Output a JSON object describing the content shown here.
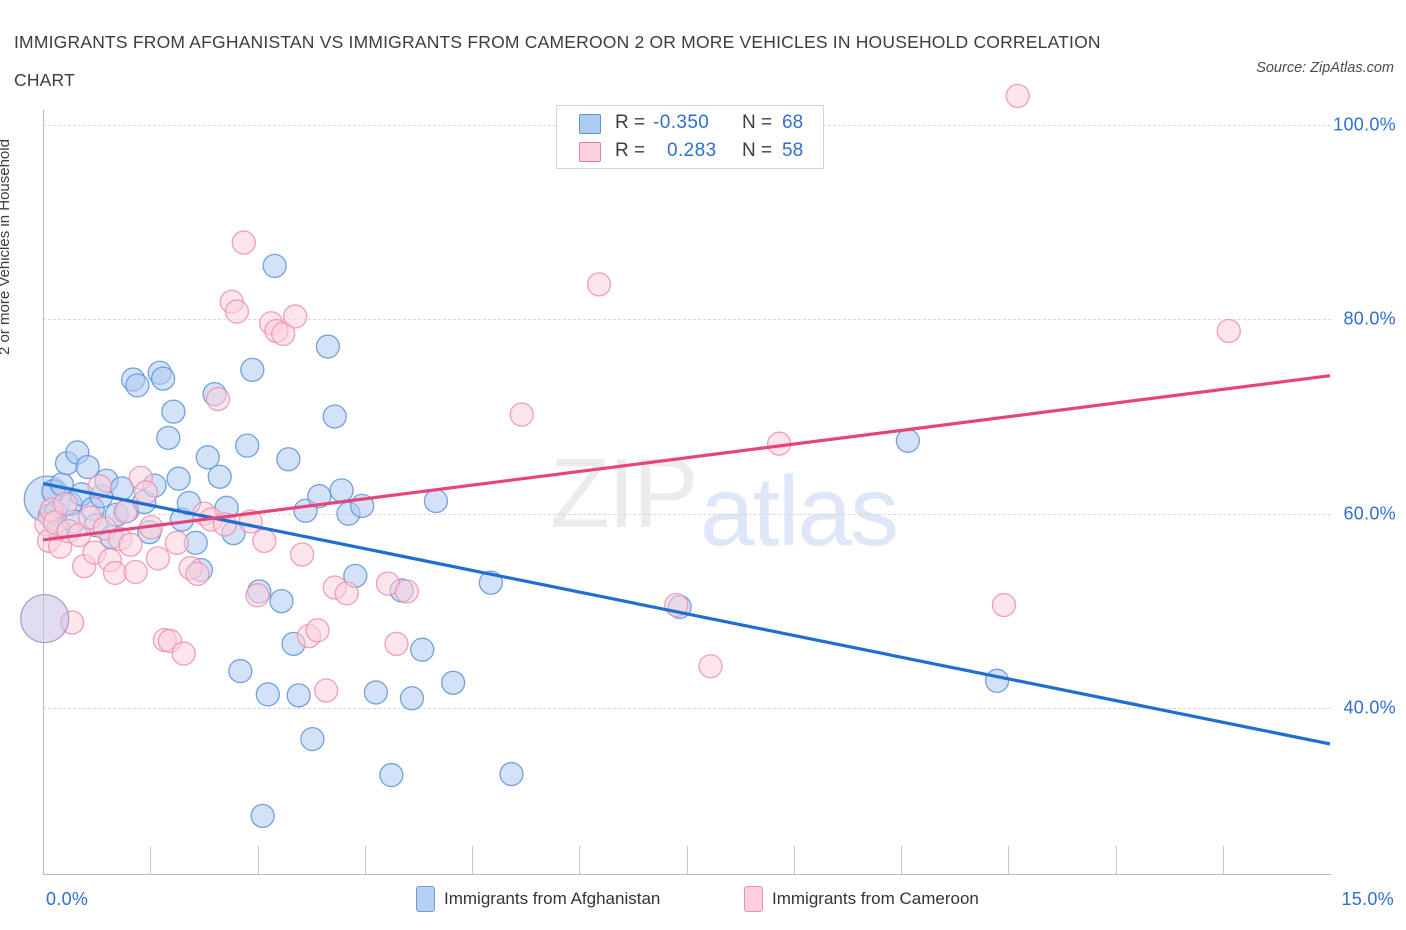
{
  "header": {
    "title_line1": "IMMIGRANTS FROM AFGHANISTAN VS IMMIGRANTS FROM CAMEROON 2 OR MORE VEHICLES IN HOUSEHOLD CORRELATION",
    "title_line2": "CHART",
    "source": "Source: ZipAtlas.com"
  },
  "watermark": {
    "part1": "ZIP",
    "part2": "atlas"
  },
  "stats": {
    "rows": [
      {
        "r_label": "R =",
        "r_value": "-0.350",
        "n_label": "N =",
        "n_value": "68",
        "color": "#aecbf0"
      },
      {
        "r_label": "R =",
        "r_value": "0.283",
        "n_label": "N =",
        "n_value": "58",
        "color": "#fbcfdd"
      }
    ]
  },
  "legend": {
    "items": [
      {
        "label": "Immigrants from Afghanistan",
        "color": "#b6d0f2"
      },
      {
        "label": "Immigrants from Cameroon",
        "color": "#fbcfdd"
      }
    ]
  },
  "chart_data": {
    "type": "scatter",
    "title": "IMMIGRANTS FROM AFGHANISTAN VS IMMIGRANTS FROM CAMEROON 2 OR MORE VEHICLES IN HOUSEHOLD CORRELATION CHART",
    "xlabel": "",
    "ylabel": "2 or more Vehicles in Household",
    "xlim": [
      0,
      15
    ],
    "ylim": [
      22.3,
      103.5
    ],
    "xtick_labels": [
      "0.0%",
      "15.0%"
    ],
    "ytick_labels": [
      "100.0%",
      "80.0%",
      "60.0%",
      "40.0%"
    ],
    "ytick_values": [
      100,
      80,
      60,
      40
    ],
    "grid": true,
    "legend_position": "bottom-center",
    "series": [
      {
        "name": "Immigrants from Afghanistan",
        "color": "#aecbf0",
        "edge": "#5d93d8",
        "r": -0.35,
        "n": 68,
        "trendline": {
          "x0": 0.0,
          "y0": 63.1,
          "x1": 15.0,
          "y1": 36.3,
          "color": "#1f6fd0"
        },
        "points": [
          [
            0.05,
            61.5
          ],
          [
            0.08,
            59.8
          ],
          [
            0.12,
            62.3
          ],
          [
            0.15,
            60.1
          ],
          [
            0.18,
            58.4
          ],
          [
            0.22,
            63.0
          ],
          [
            0.28,
            65.2
          ],
          [
            0.32,
            61.0
          ],
          [
            0.36,
            59.2
          ],
          [
            0.4,
            66.3
          ],
          [
            0.45,
            62.0
          ],
          [
            0.52,
            64.8
          ],
          [
            0.58,
            60.5
          ],
          [
            0.62,
            58.8
          ],
          [
            0.68,
            61.8
          ],
          [
            0.74,
            63.4
          ],
          [
            0.8,
            57.6
          ],
          [
            0.86,
            59.9
          ],
          [
            0.92,
            62.6
          ],
          [
            0.98,
            60.3
          ],
          [
            1.05,
            73.8
          ],
          [
            1.1,
            73.2
          ],
          [
            1.18,
            61.2
          ],
          [
            1.24,
            58.1
          ],
          [
            1.3,
            62.9
          ],
          [
            1.36,
            74.5
          ],
          [
            1.4,
            73.9
          ],
          [
            1.46,
            67.8
          ],
          [
            1.52,
            70.5
          ],
          [
            1.58,
            63.6
          ],
          [
            1.62,
            59.4
          ],
          [
            1.7,
            61.1
          ],
          [
            1.78,
            57.0
          ],
          [
            1.84,
            54.2
          ],
          [
            1.92,
            65.8
          ],
          [
            2.0,
            72.3
          ],
          [
            2.06,
            63.8
          ],
          [
            2.14,
            60.6
          ],
          [
            2.22,
            58.0
          ],
          [
            2.3,
            43.8
          ],
          [
            2.38,
            67.0
          ],
          [
            2.44,
            74.8
          ],
          [
            2.52,
            52.0
          ],
          [
            2.56,
            28.9
          ],
          [
            2.62,
            41.4
          ],
          [
            2.7,
            85.5
          ],
          [
            2.78,
            51.0
          ],
          [
            2.86,
            65.6
          ],
          [
            2.92,
            46.6
          ],
          [
            2.98,
            41.3
          ],
          [
            3.06,
            60.3
          ],
          [
            3.14,
            36.8
          ],
          [
            3.22,
            61.8
          ],
          [
            3.32,
            77.2
          ],
          [
            3.4,
            70.0
          ],
          [
            3.48,
            62.4
          ],
          [
            3.56,
            60.0
          ],
          [
            3.64,
            53.6
          ],
          [
            3.72,
            60.8
          ],
          [
            3.88,
            41.6
          ],
          [
            4.06,
            33.1
          ],
          [
            4.18,
            52.1
          ],
          [
            4.3,
            41.0
          ],
          [
            4.42,
            46.0
          ],
          [
            4.58,
            61.3
          ],
          [
            4.78,
            42.6
          ],
          [
            5.22,
            52.9
          ],
          [
            5.46,
            33.2
          ],
          [
            7.42,
            50.4
          ],
          [
            10.08,
            67.5
          ],
          [
            11.12,
            42.8
          ]
        ]
      },
      {
        "name": "Immigrants from Cameroon",
        "color": "#fbcfdd",
        "edge": "#ef8fae",
        "r": 0.283,
        "n": 58,
        "trendline": {
          "x0": 0.0,
          "y0": 57.3,
          "x1": 15.0,
          "y1": 74.2,
          "color": "#e8447c"
        },
        "points": [
          [
            0.04,
            58.9
          ],
          [
            0.07,
            57.2
          ],
          [
            0.1,
            60.4
          ],
          [
            0.14,
            59.1
          ],
          [
            0.2,
            56.6
          ],
          [
            0.26,
            61.0
          ],
          [
            0.3,
            58.2
          ],
          [
            0.34,
            48.8
          ],
          [
            0.42,
            57.8
          ],
          [
            0.48,
            54.6
          ],
          [
            0.55,
            59.6
          ],
          [
            0.6,
            56.0
          ],
          [
            0.66,
            62.8
          ],
          [
            0.72,
            58.5
          ],
          [
            0.78,
            55.2
          ],
          [
            0.84,
            53.9
          ],
          [
            0.9,
            57.4
          ],
          [
            0.96,
            60.2
          ],
          [
            1.02,
            56.8
          ],
          [
            1.08,
            54.0
          ],
          [
            1.14,
            63.7
          ],
          [
            1.2,
            62.2
          ],
          [
            1.26,
            58.6
          ],
          [
            1.34,
            55.4
          ],
          [
            1.42,
            47.0
          ],
          [
            1.48,
            46.9
          ],
          [
            1.56,
            57.0
          ],
          [
            1.64,
            45.6
          ],
          [
            1.72,
            54.4
          ],
          [
            1.8,
            53.8
          ],
          [
            1.88,
            60.0
          ],
          [
            1.96,
            59.4
          ],
          [
            2.04,
            71.8
          ],
          [
            2.12,
            58.9
          ],
          [
            2.2,
            81.8
          ],
          [
            2.26,
            80.8
          ],
          [
            2.34,
            87.9
          ],
          [
            2.42,
            59.2
          ],
          [
            2.5,
            51.6
          ],
          [
            2.58,
            57.2
          ],
          [
            2.66,
            79.6
          ],
          [
            2.72,
            78.8
          ],
          [
            2.8,
            78.5
          ],
          [
            2.94,
            80.3
          ],
          [
            3.02,
            55.8
          ],
          [
            3.1,
            47.4
          ],
          [
            3.2,
            48.0
          ],
          [
            3.3,
            41.8
          ],
          [
            3.4,
            52.4
          ],
          [
            3.54,
            51.8
          ],
          [
            4.02,
            52.8
          ],
          [
            4.12,
            46.6
          ],
          [
            4.24,
            52.0
          ],
          [
            5.58,
            70.2
          ],
          [
            6.48,
            83.6
          ],
          [
            7.38,
            50.6
          ],
          [
            7.78,
            44.3
          ],
          [
            8.58,
            67.2
          ],
          [
            11.2,
            50.6
          ],
          [
            11.36,
            103.0
          ],
          [
            13.82,
            78.8
          ]
        ]
      }
    ]
  }
}
